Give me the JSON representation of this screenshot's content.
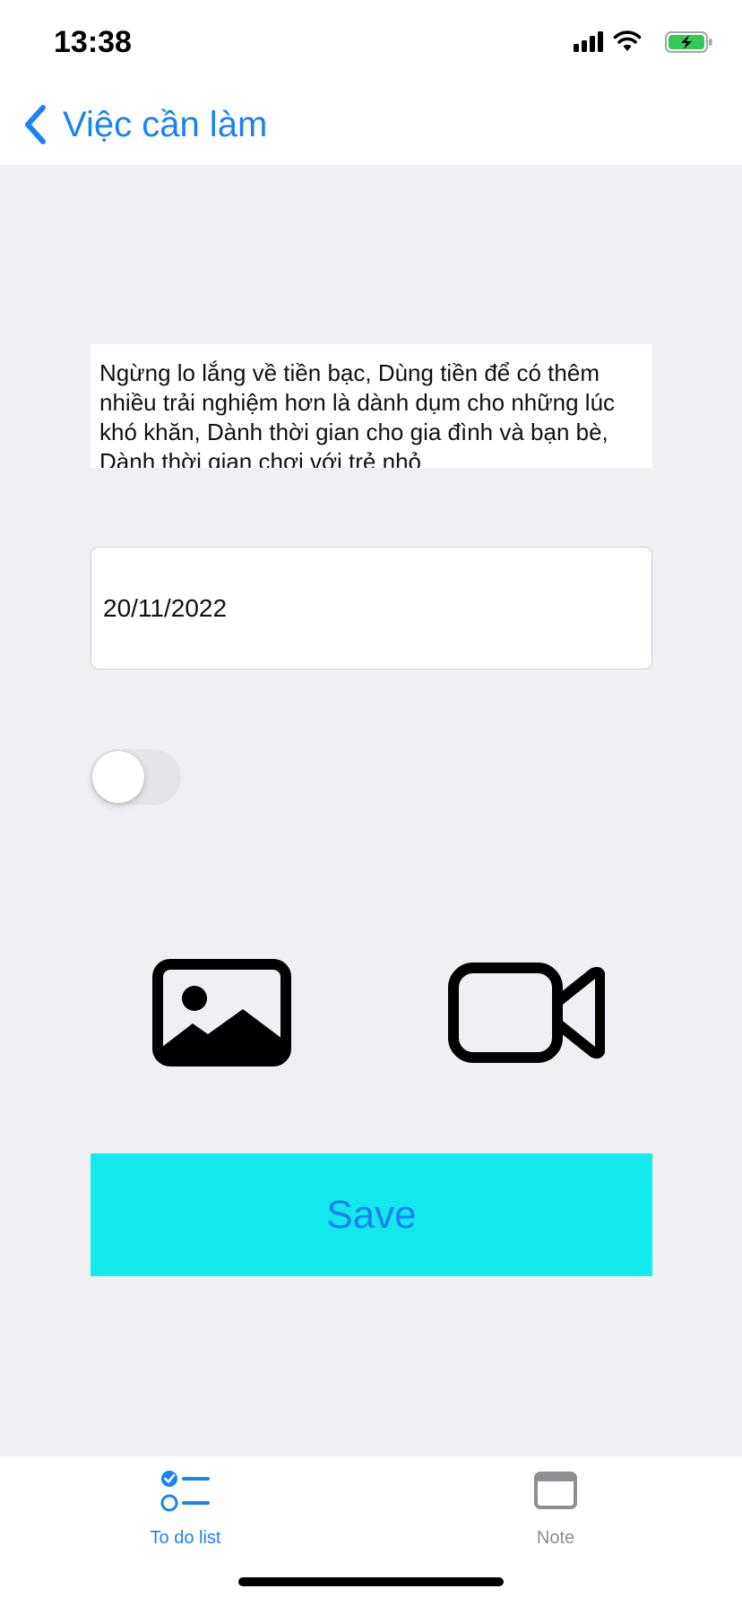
{
  "status_bar": {
    "time": "13:38",
    "icons": [
      "cellular-signal-icon",
      "wifi-icon",
      "battery-charging-icon"
    ],
    "battery_color": "#34c759"
  },
  "nav": {
    "back_label": "Việc cần làm"
  },
  "form": {
    "note_text": "Ngừng lo lắng về tiền bạc, Dùng tiền để có thêm nhiều trải nghiệm hơn là dành dụm cho những lúc khó khăn, Dành thời gian cho gia đình và bạn bè, Dành thời gian chơi với trẻ nhỏ",
    "date_value": "20/11/2022",
    "toggle_on": false,
    "photo_icon": "photo-icon",
    "video_icon": "video-camera-icon",
    "save_label": "Save"
  },
  "tabs": [
    {
      "label": "To do list",
      "icon": "checklist-icon",
      "selected": true
    },
    {
      "label": "Note",
      "icon": "window-icon",
      "selected": false
    }
  ],
  "colors": {
    "accent": "#1a82f3",
    "save_bg": "#13e8ec",
    "background": "#efeff4",
    "inactive_tab": "#8e8e93"
  }
}
